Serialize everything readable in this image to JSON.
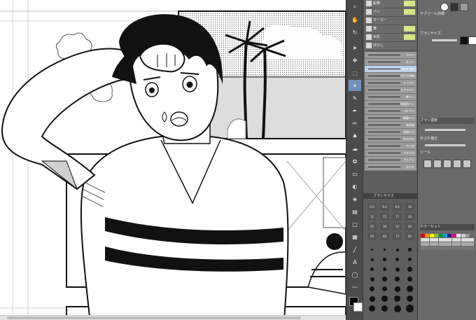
{
  "canvas": {
    "art": "manga-page",
    "colors": {
      "ink": "#111111",
      "guide": "#c9c9c9",
      "paper": "#ffffff"
    }
  },
  "toolbar": {
    "tools": [
      {
        "name": "zoom-icon",
        "glyph": "⌕"
      },
      {
        "name": "hand-icon",
        "glyph": "✋"
      },
      {
        "name": "rotate-icon",
        "glyph": "↻"
      },
      {
        "name": "operation-icon",
        "glyph": "➤"
      },
      {
        "name": "move-layer-icon",
        "glyph": "✥"
      },
      {
        "name": "selection-icon",
        "glyph": "⬚"
      },
      {
        "name": "auto-select-icon",
        "glyph": "✦"
      },
      {
        "name": "eyedropper-icon",
        "glyph": "✎"
      },
      {
        "name": "pen-icon",
        "glyph": "✒"
      },
      {
        "name": "pencil-icon",
        "glyph": "✏"
      },
      {
        "name": "brush-icon",
        "glyph": "♠"
      },
      {
        "name": "airbrush-icon",
        "glyph": "☁"
      },
      {
        "name": "decoration-icon",
        "glyph": "✿"
      },
      {
        "name": "eraser-icon",
        "glyph": "▭"
      },
      {
        "name": "blend-icon",
        "glyph": "◐"
      },
      {
        "name": "fill-icon",
        "glyph": "◈"
      },
      {
        "name": "gradient-icon",
        "glyph": "▤"
      },
      {
        "name": "figure-icon",
        "glyph": "□"
      },
      {
        "name": "frame-icon",
        "glyph": "▦"
      },
      {
        "name": "ruler-icon",
        "glyph": "╱"
      },
      {
        "name": "text-icon",
        "glyph": "A"
      },
      {
        "name": "balloon-icon",
        "glyph": "◯"
      },
      {
        "name": "correct-line-icon",
        "glyph": "〰"
      }
    ]
  },
  "subtools": {
    "tabs": [
      {
        "label": "鉛筆"
      },
      {
        "label": "ペン"
      },
      {
        "label": "マーカー"
      },
      {
        "label": "筆"
      },
      {
        "label": "水彩"
      },
      {
        "label": "ぼかし"
      }
    ],
    "brushes": [
      {
        "label": "Gペン"
      },
      {
        "label": "丸ペン"
      },
      {
        "label": "rawe pen"
      },
      {
        "label": "YOTTI-PEN"
      },
      {
        "label": "ミリペン"
      },
      {
        "label": "カブラペン"
      },
      {
        "label": "筆ペン"
      },
      {
        "label": "線画用ペン"
      },
      {
        "label": "つけペン"
      },
      {
        "label": "細線ペン"
      },
      {
        "label": "効果線"
      },
      {
        "label": "強弱ペン"
      },
      {
        "label": "Synchro"
      },
      {
        "label": "ペン先"
      },
      {
        "label": "ガタガタ"
      },
      {
        "label": "ざらざら"
      },
      {
        "label": "かすれ"
      }
    ],
    "brush_size_header": "ブラシサイズ",
    "size_values": [
      "4.0",
      "6.0",
      "8.0",
      "10",
      "12",
      "15",
      "17",
      "20",
      "25",
      "30",
      "35",
      "40",
      "50",
      "60",
      "70",
      "80"
    ]
  },
  "properties": {
    "header": "サブツール詳細",
    "rows": [
      {
        "label": "ブラシサイズ"
      },
      {
        "label": "ブラシ濃度"
      },
      {
        "label": "手ぶれ補正"
      },
      {
        "label": "ツール"
      }
    ],
    "color_header": "カラーセット"
  }
}
